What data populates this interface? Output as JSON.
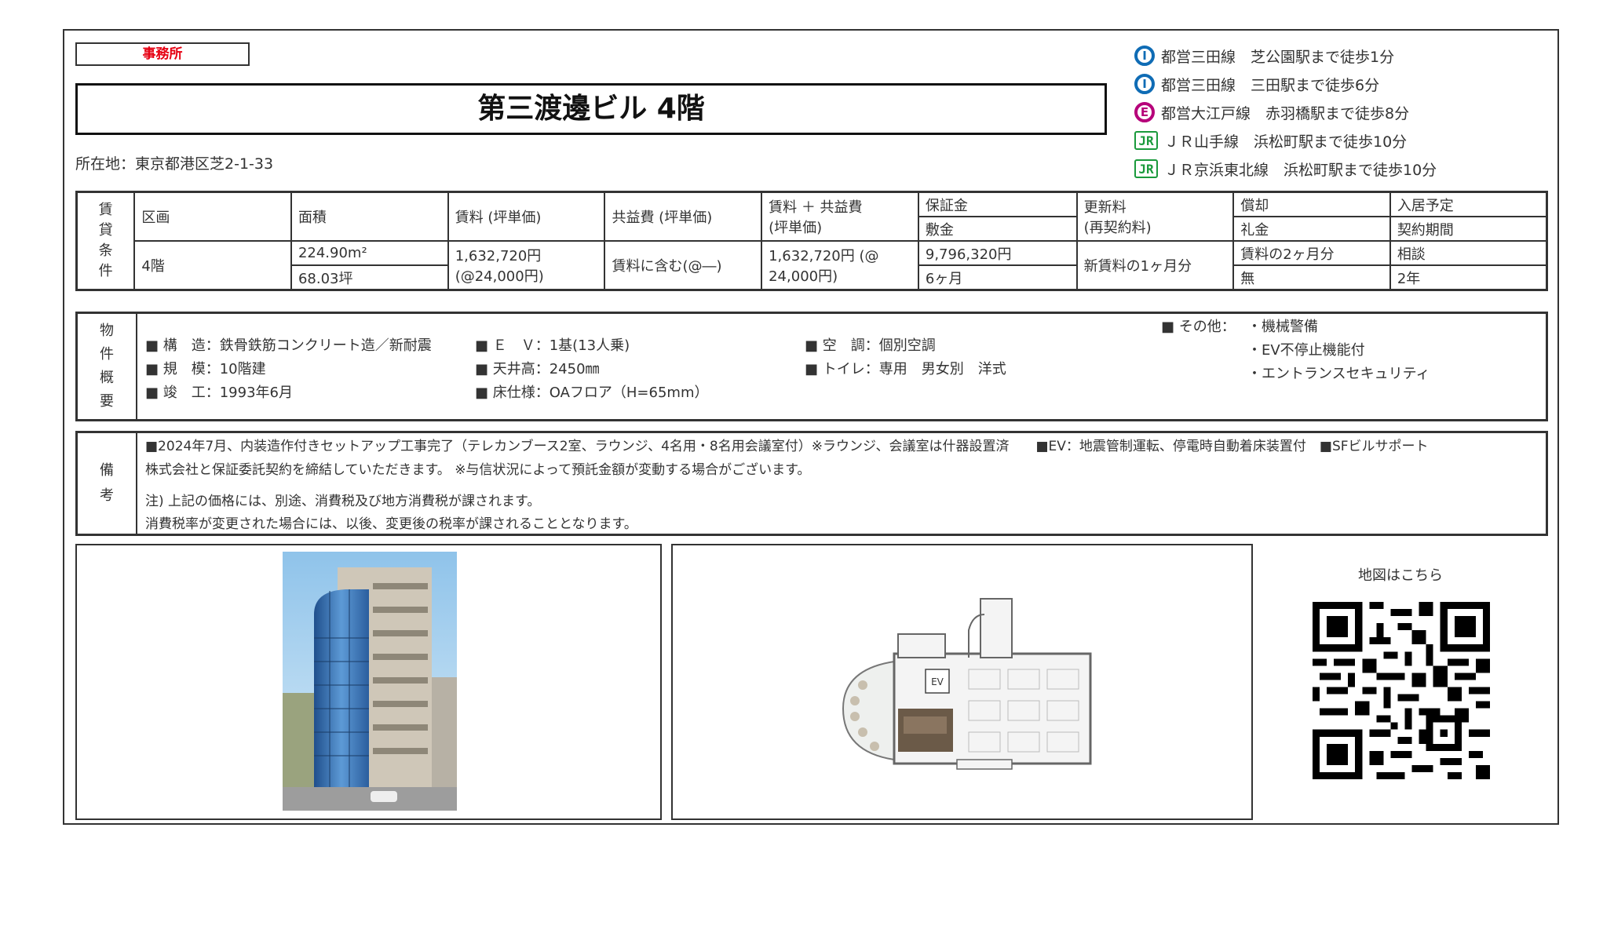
{
  "tag": "事務所",
  "title": "第三渡邊ビル 4階",
  "address": "所在地：東京都港区芝2-1-33",
  "stations": [
    {
      "icon": "mita-line-icon",
      "mark": "I",
      "kind": "mita",
      "text": "都営三田線　芝公園駅まで徒歩1分"
    },
    {
      "icon": "mita-line-icon",
      "mark": "I",
      "kind": "mita",
      "text": "都営三田線　三田駅まで徒歩6分"
    },
    {
      "icon": "oedo-line-icon",
      "mark": "E",
      "kind": "oedo",
      "text": "都営大江戸線　赤羽橋駅まで徒歩8分"
    },
    {
      "icon": "jr-icon",
      "mark": "JR",
      "kind": "jr",
      "text": "ＪＲ山手線　浜松町駅まで徒歩10分"
    },
    {
      "icon": "jr-icon",
      "mark": "JR",
      "kind": "jr",
      "text": "ＪＲ京浜東北線　浜松町駅まで徒歩10分"
    }
  ],
  "rent": {
    "side_label": [
      "賃",
      "貸",
      "条",
      "件"
    ],
    "headers": {
      "section": "区画",
      "area": "面積",
      "rent": "賃料 (坪単価)",
      "common": "共益費 (坪単価)",
      "total_1": "賃料 ＋ 共益費",
      "total_2": "(坪単価)",
      "deposit": "保証金",
      "shikikin": "敷金",
      "renewal_1": "更新料",
      "renewal_2": "(再契約料)",
      "amortization": "償却",
      "key_money": "礼金",
      "move_in": "入居予定",
      "contract": "契約期間"
    },
    "values": {
      "section": "4階",
      "area_m2": "224.90m²",
      "area_tsubo": "68.03坪",
      "rent_1": "1,632,720円",
      "rent_2": "(@24,000円)",
      "common": "賃料に含む(@―)",
      "total_1": "1,632,720円 (@",
      "total_2": "24,000円)",
      "deposit": "9,796,320円",
      "shikikin": "6ヶ月",
      "renewal": "新賃料の1ヶ月分",
      "amortization": "賃料の2ヶ月分",
      "key_money": "無",
      "move_in": "相談",
      "contract": "2年"
    }
  },
  "overview": {
    "side_label": [
      "物",
      "件",
      "概",
      "要"
    ],
    "col1": [
      "■ 構　造：鉄骨鉄筋コンクリート造／新耐震",
      "■ 規　模：10階建",
      "■ 竣　工：1993年6月"
    ],
    "col2": [
      "■ Ｅ　Ｖ：1基(13人乗)",
      "■ 天井高：2450㎜",
      "■ 床仕様：OAフロア（H=65mm）"
    ],
    "col3": [
      "■ 空　調：個別空調",
      "■ トイレ：専用　男女別　洋式"
    ],
    "other_label": "■ その他：",
    "other": [
      "・機械警備",
      "・EV不停止機能付",
      "・エントランスセキュリティ"
    ]
  },
  "remarks": {
    "side_label": [
      "備",
      "考"
    ],
    "line1": "■2024年7月、内装造作付きセットアップ工事完了（テレカンブース2室、ラウンジ、4名用・8名用会議室付）※ラウンジ、会議室は什器設置済　　■EV：地震管制運転、停電時自動着床装置付　■SFビルサポート",
    "line2": "株式会社と保証委託契約を締結していただきます。 ※与信状況によって預託金額が変動する場合がございます。",
    "line3": "注) 上記の価格には、別途、消費税及び地方消費税が課されます。",
    "line4": "消費税率が変更された場合には、以後、変更後の税率が課されることとなります。"
  },
  "floorplan": {
    "ev_label": "EV"
  },
  "map": {
    "label": "地図はこちら"
  },
  "colors": {
    "accent_red": "#e60012",
    "mita_blue": "#0f6cb5",
    "oedo_magenta": "#b6007a",
    "jr_green": "#1a9a3c"
  }
}
